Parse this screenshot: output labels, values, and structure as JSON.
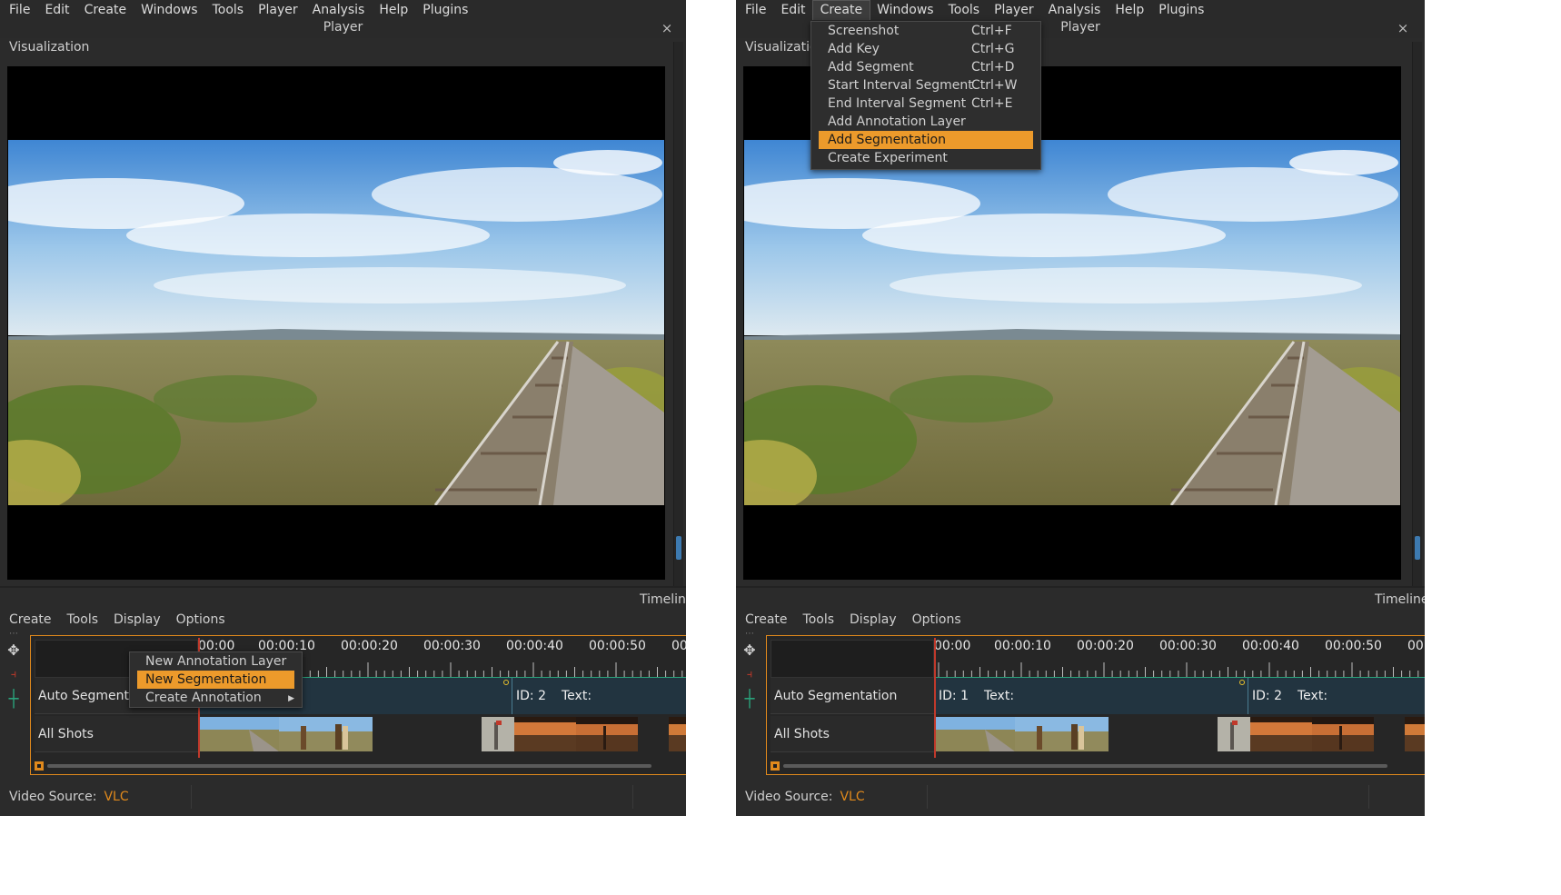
{
  "menus": [
    "File",
    "Edit",
    "Create",
    "Windows",
    "Tools",
    "Player",
    "Analysis",
    "Help",
    "Plugins"
  ],
  "player_title": "Player",
  "close_symbol": "×",
  "visualization_label": "Visualization",
  "timeline_title": "Timeline",
  "timeline_title_right": "Timeline",
  "timeline_menus": [
    "Create",
    "Tools",
    "Display",
    "Options"
  ],
  "ruler_left": [
    "00:00",
    "00:00:10",
    "00:00:20",
    "00:00:30",
    "00:00:40",
    "00:00:50",
    "00"
  ],
  "ruler_right": [
    "00:00",
    "00:00:10",
    "00:00:20",
    "00:00:30",
    "00:00:40",
    "00:00:50",
    "00"
  ],
  "tracks": {
    "auto_left": "Auto Segment",
    "auto_right": "Auto Segmentation",
    "shots": "All Shots"
  },
  "segments": {
    "seg1_id": "ID: 1",
    "seg1_text": "Text:",
    "seg2_id": "ID: 2",
    "seg2_text": "Text:"
  },
  "context_menu": {
    "items": [
      "New Annotation Layer",
      "New Segmentation",
      "Create Annotation"
    ],
    "highlighted_index": 1,
    "submenu_arrow": "▶"
  },
  "create_menu": {
    "items": [
      {
        "label": "Screenshot",
        "shortcut": "Ctrl+F"
      },
      {
        "label": "Add Key",
        "shortcut": "Ctrl+G"
      },
      {
        "label": "Add Segment",
        "shortcut": "Ctrl+D"
      },
      {
        "label": "Start Interval Segment",
        "shortcut": "Ctrl+W"
      },
      {
        "label": "End Interval Segment",
        "shortcut": "Ctrl+E"
      },
      {
        "label": "Add Annotation Layer",
        "shortcut": ""
      },
      {
        "label": "Add Segmentation",
        "shortcut": ""
      },
      {
        "label": "Create Experiment",
        "shortcut": ""
      }
    ],
    "highlighted_index": 6
  },
  "status": {
    "label": "Video Source:",
    "value": "VLC"
  },
  "colors": {
    "accent": "#e0891c",
    "highlight": "#ec9a2b",
    "playhead": "#c0392b",
    "ruler_line": "#2aa17a"
  }
}
